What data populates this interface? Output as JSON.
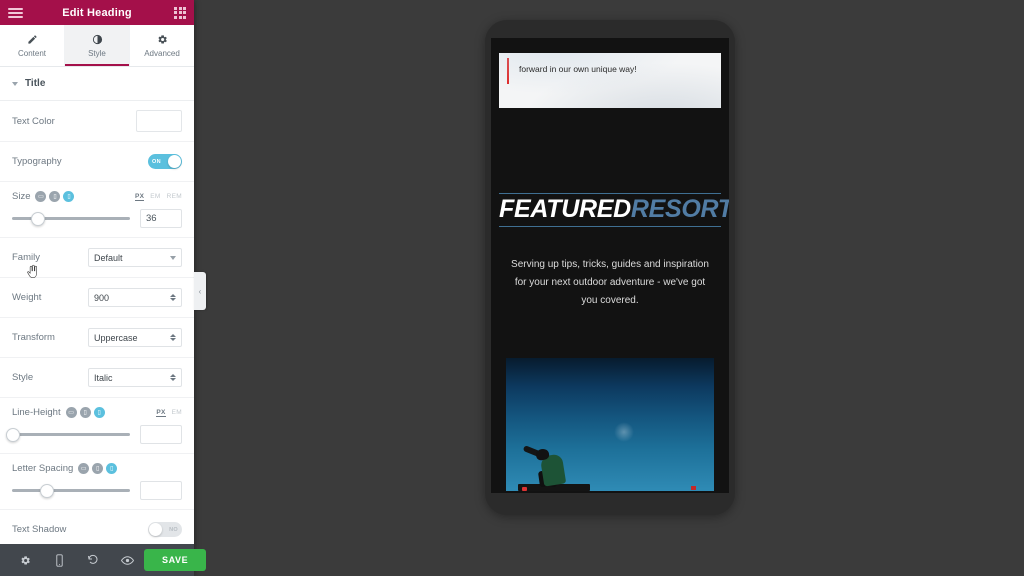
{
  "panel": {
    "header": {
      "title": "Edit Heading",
      "menu_icon": "hamburger-icon",
      "widgets_icon": "grid-widgets-icon"
    },
    "tabs": [
      {
        "label": "Content",
        "icon": "pencil-icon",
        "active": false
      },
      {
        "label": "Style",
        "icon": "contrast-icon",
        "active": true
      },
      {
        "label": "Advanced",
        "icon": "gear-icon",
        "active": false
      }
    ],
    "section": {
      "label": "Title",
      "expanded": true
    },
    "controls": {
      "text_color": {
        "label": "Text Color",
        "value": ""
      },
      "typography": {
        "label": "Typography",
        "toggle_state": "ON",
        "enabled": true
      },
      "size": {
        "label": "Size",
        "devices": [
          "desktop",
          "tablet",
          "mobile"
        ],
        "active_device": "mobile",
        "units": [
          "PX",
          "EM",
          "REM"
        ],
        "active_unit": "PX",
        "value": "36",
        "slider_percent": 22
      },
      "family": {
        "label": "Family",
        "value": "Default"
      },
      "weight": {
        "label": "Weight",
        "value": "900"
      },
      "transform": {
        "label": "Transform",
        "value": "Uppercase"
      },
      "style": {
        "label": "Style",
        "value": "Italic"
      },
      "line_height": {
        "label": "Line-Height",
        "devices": [
          "desktop",
          "tablet",
          "mobile"
        ],
        "active_device": "mobile",
        "units": [
          "PX",
          "EM"
        ],
        "active_unit": "PX",
        "value": "",
        "slider_percent": 0
      },
      "letter_spacing": {
        "label": "Letter Spacing",
        "devices": [
          "desktop",
          "tablet",
          "mobile"
        ],
        "active_device": "mobile",
        "value": "",
        "slider_percent": 30
      },
      "text_shadow": {
        "label": "Text Shadow",
        "toggle_state": "NO",
        "enabled": false
      }
    },
    "footer": {
      "settings_icon": "gear-icon",
      "responsive_icon": "mobile-device-icon",
      "history_icon": "undo-history-icon",
      "preview_icon": "eye-preview-icon",
      "save_label": "SAVE",
      "save_color": "#39b54a"
    },
    "collapse_label": "‹"
  },
  "preview": {
    "quote_text": "forward in our own unique way!",
    "heading": {
      "word_white": "FEATURED",
      "word_blue": "RESORTS",
      "blue_color": "#517ca4"
    },
    "subtext": "Serving up tips, tricks, guides and inspiration for your next outdoor adventure - we've got you covered.",
    "photo_alt": "skateboarder-silhouette-photo"
  }
}
